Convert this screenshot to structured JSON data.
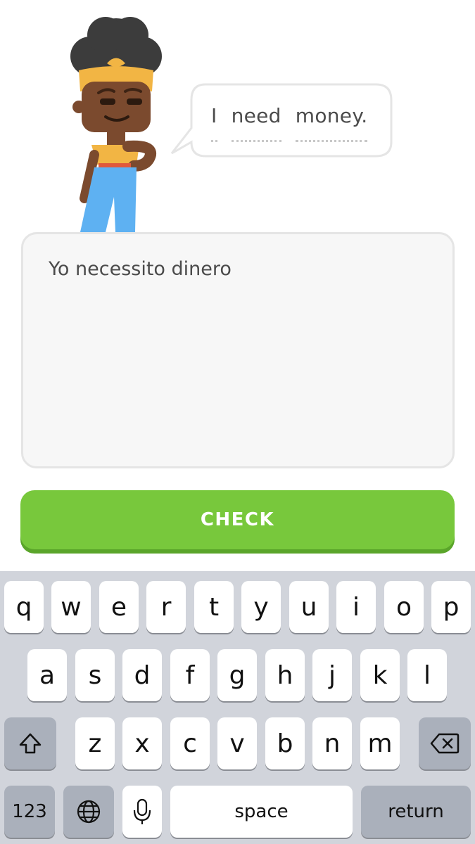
{
  "speech": {
    "words": [
      "I",
      "need",
      "money."
    ]
  },
  "answer": {
    "value": "Yo necessito dinero"
  },
  "check_button": {
    "label": "CHECK"
  },
  "keyboard": {
    "row1": [
      "q",
      "w",
      "e",
      "r",
      "t",
      "y",
      "u",
      "i",
      "o",
      "p"
    ],
    "row2": [
      "a",
      "s",
      "d",
      "f",
      "g",
      "h",
      "j",
      "k",
      "l"
    ],
    "row3": [
      "z",
      "x",
      "c",
      "v",
      "b",
      "n",
      "m"
    ],
    "numbers_label": "123",
    "space_label": "space",
    "return_label": "return",
    "shift_icon": "shift-icon",
    "delete_icon": "delete-icon",
    "globe_icon": "globe-icon",
    "mic_icon": "microphone-icon"
  },
  "colors": {
    "check_green": "#78c83c",
    "check_shadow": "#5aa52a",
    "keyboard_bg": "#d1d4db",
    "text": "#4b4b4b"
  }
}
